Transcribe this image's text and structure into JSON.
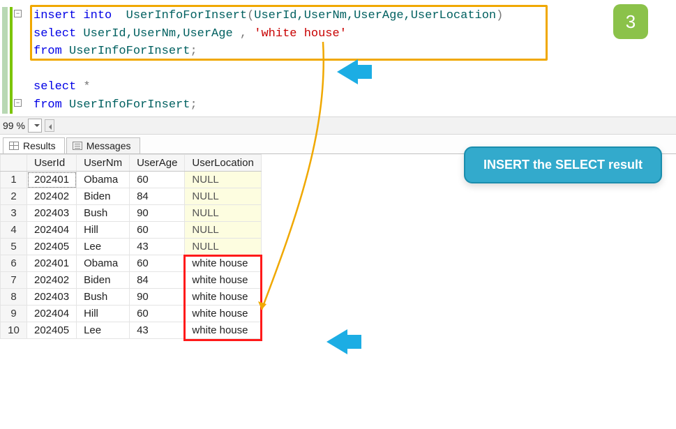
{
  "step_badge": "3",
  "code": {
    "line1": {
      "kw1": "insert",
      "kw2": "into",
      "tbl": "UserInfoForInsert",
      "cols_open": "(",
      "cols": "UserId,UserNm,UserAge,UserLocation",
      "cols_close": ")"
    },
    "line2": {
      "kw": "select",
      "cols": "UserId,UserNm,UserAge",
      "comma": " , ",
      "str": "'white house'"
    },
    "line3": {
      "kw": "from",
      "tbl": "UserInfoForInsert",
      "semi": ";"
    },
    "line5": {
      "kw": "select",
      "star": " *"
    },
    "line6": {
      "kw": "from",
      "tbl": "UserInfoForInsert",
      "semi": ";"
    }
  },
  "zoom": "99 %",
  "tabs": {
    "results": "Results",
    "messages": "Messages"
  },
  "grid": {
    "columns": [
      "UserId",
      "UserNm",
      "UserAge",
      "UserLocation"
    ],
    "rows": [
      {
        "n": "1",
        "UserId": "202401",
        "UserNm": "Obama",
        "UserAge": "60",
        "UserLocation": "NULL",
        "null": true
      },
      {
        "n": "2",
        "UserId": "202402",
        "UserNm": "Biden",
        "UserAge": "84",
        "UserLocation": "NULL",
        "null": true
      },
      {
        "n": "3",
        "UserId": "202403",
        "UserNm": "Bush",
        "UserAge": "90",
        "UserLocation": "NULL",
        "null": true
      },
      {
        "n": "4",
        "UserId": "202404",
        "UserNm": "Hill",
        "UserAge": "60",
        "UserLocation": "NULL",
        "null": true
      },
      {
        "n": "5",
        "UserId": "202405",
        "UserNm": "Lee",
        "UserAge": "43",
        "UserLocation": "NULL",
        "null": true
      },
      {
        "n": "6",
        "UserId": "202401",
        "UserNm": "Obama",
        "UserAge": "60",
        "UserLocation": "white house",
        "null": false
      },
      {
        "n": "7",
        "UserId": "202402",
        "UserNm": "Biden",
        "UserAge": "84",
        "UserLocation": "white house",
        "null": false
      },
      {
        "n": "8",
        "UserId": "202403",
        "UserNm": "Bush",
        "UserAge": "90",
        "UserLocation": "white house",
        "null": false
      },
      {
        "n": "9",
        "UserId": "202404",
        "UserNm": "Hill",
        "UserAge": "60",
        "UserLocation": "white house",
        "null": false
      },
      {
        "n": "10",
        "UserId": "202405",
        "UserNm": "Lee",
        "UserAge": "43",
        "UserLocation": "white house",
        "null": false
      }
    ]
  },
  "callout": "INSERT the SELECT result"
}
